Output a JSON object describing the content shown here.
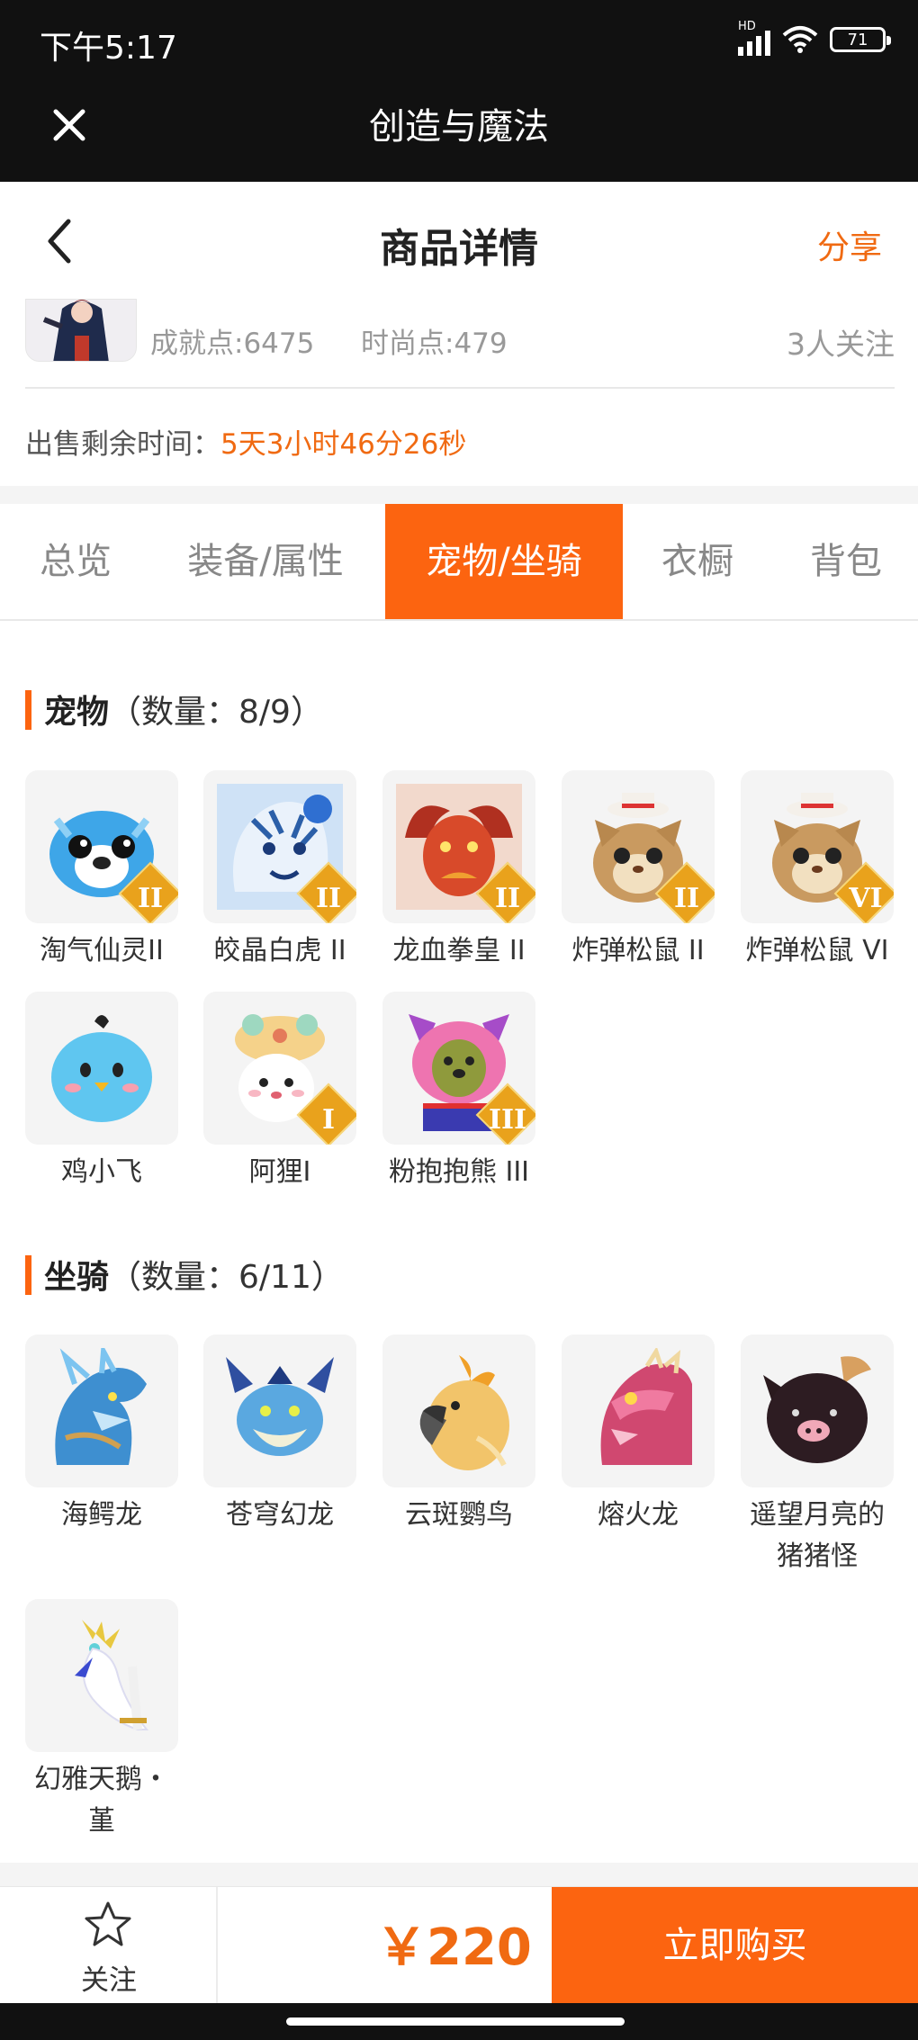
{
  "status_bar": {
    "time": "下午5:17",
    "network": "HD",
    "battery": "71"
  },
  "app_bar": {
    "title": "创造与魔法"
  },
  "header": {
    "title": "商品详情",
    "share": "分享"
  },
  "seller": {
    "achievement": "成就点:6475",
    "fashion": "时尚点:479",
    "followers": "3人关注"
  },
  "timer": {
    "label": "出售剩余时间：",
    "value": "5天3小时46分26秒"
  },
  "tabs": [
    {
      "label": "总览",
      "active": false
    },
    {
      "label": "装备/属性",
      "active": false
    },
    {
      "label": "宠物/坐骑",
      "active": true
    },
    {
      "label": "衣橱",
      "active": false
    },
    {
      "label": "背包",
      "active": false
    }
  ],
  "pets": {
    "title": "宠物",
    "count": "（数量：8/9）",
    "items": [
      {
        "name": "淘气仙灵II",
        "rank": "II",
        "icon": "blue-dog-pet"
      },
      {
        "name": "皎晶白虎 II",
        "rank": "II",
        "icon": "white-tiger-pet"
      },
      {
        "name": "龙血拳皇 II",
        "rank": "II",
        "icon": "ram-dragon-pet"
      },
      {
        "name": "炸弹松鼠 II",
        "rank": "II",
        "icon": "squirrel-pet"
      },
      {
        "name": "炸弹松鼠 VI",
        "rank": "VI",
        "icon": "squirrel-pet"
      },
      {
        "name": "鸡小飞",
        "rank": "",
        "icon": "blue-chick-pet"
      },
      {
        "name": "阿狸I",
        "rank": "I",
        "icon": "cat-doll-pet"
      },
      {
        "name": "粉抱抱熊 III",
        "rank": "III",
        "icon": "pink-bear-pet"
      }
    ]
  },
  "mounts": {
    "title": "坐骑",
    "count": "（数量：6/11）",
    "items": [
      {
        "name": "海鳄龙",
        "icon": "sea-dragon-mount"
      },
      {
        "name": "苍穹幻龙",
        "icon": "sky-dragon-mount"
      },
      {
        "name": "云斑鹦鸟",
        "icon": "parrot-mount"
      },
      {
        "name": "熔火龙",
        "icon": "fire-dragon-mount"
      },
      {
        "name": "遥望月亮的猪猪怪",
        "icon": "pig-mount"
      },
      {
        "name": "幻雅天鹅·堇",
        "icon": "swan-mount"
      }
    ]
  },
  "mount_names_display": [
    "海鳄龙",
    "苍穹幻龙",
    "云斑鹦鸟",
    "熔火龙",
    "遥望月亮的",
    "猪猪怪",
    "幻雅天鹅・",
    "堇"
  ],
  "footer": {
    "follow": "关注",
    "price": "￥220",
    "buy": "立即购买"
  },
  "colors": {
    "accent": "#fc6410",
    "accent_text": "#f06a12",
    "dark_bar": "#111111"
  }
}
